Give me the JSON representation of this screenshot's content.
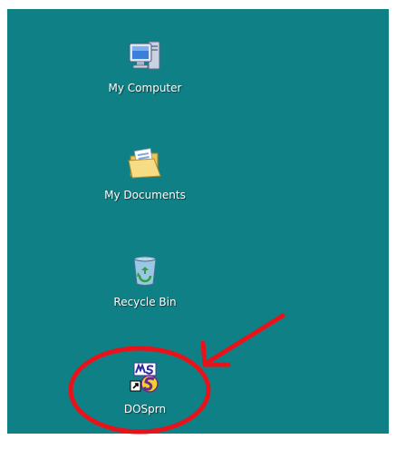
{
  "desktop": {
    "background_color": "#0f8186",
    "icons": [
      {
        "label": "My Computer",
        "icon": "my-computer-icon"
      },
      {
        "label": "My Documents",
        "icon": "my-documents-icon"
      },
      {
        "label": "Recycle Bin",
        "icon": "recycle-bin-icon"
      },
      {
        "label": "DOSprn",
        "icon": "dosprn-shortcut-icon"
      }
    ]
  },
  "annotation": {
    "color": "#e8121b",
    "shapes": [
      "circle-around-dosprn",
      "arrow-pointing-to-dosprn"
    ]
  }
}
